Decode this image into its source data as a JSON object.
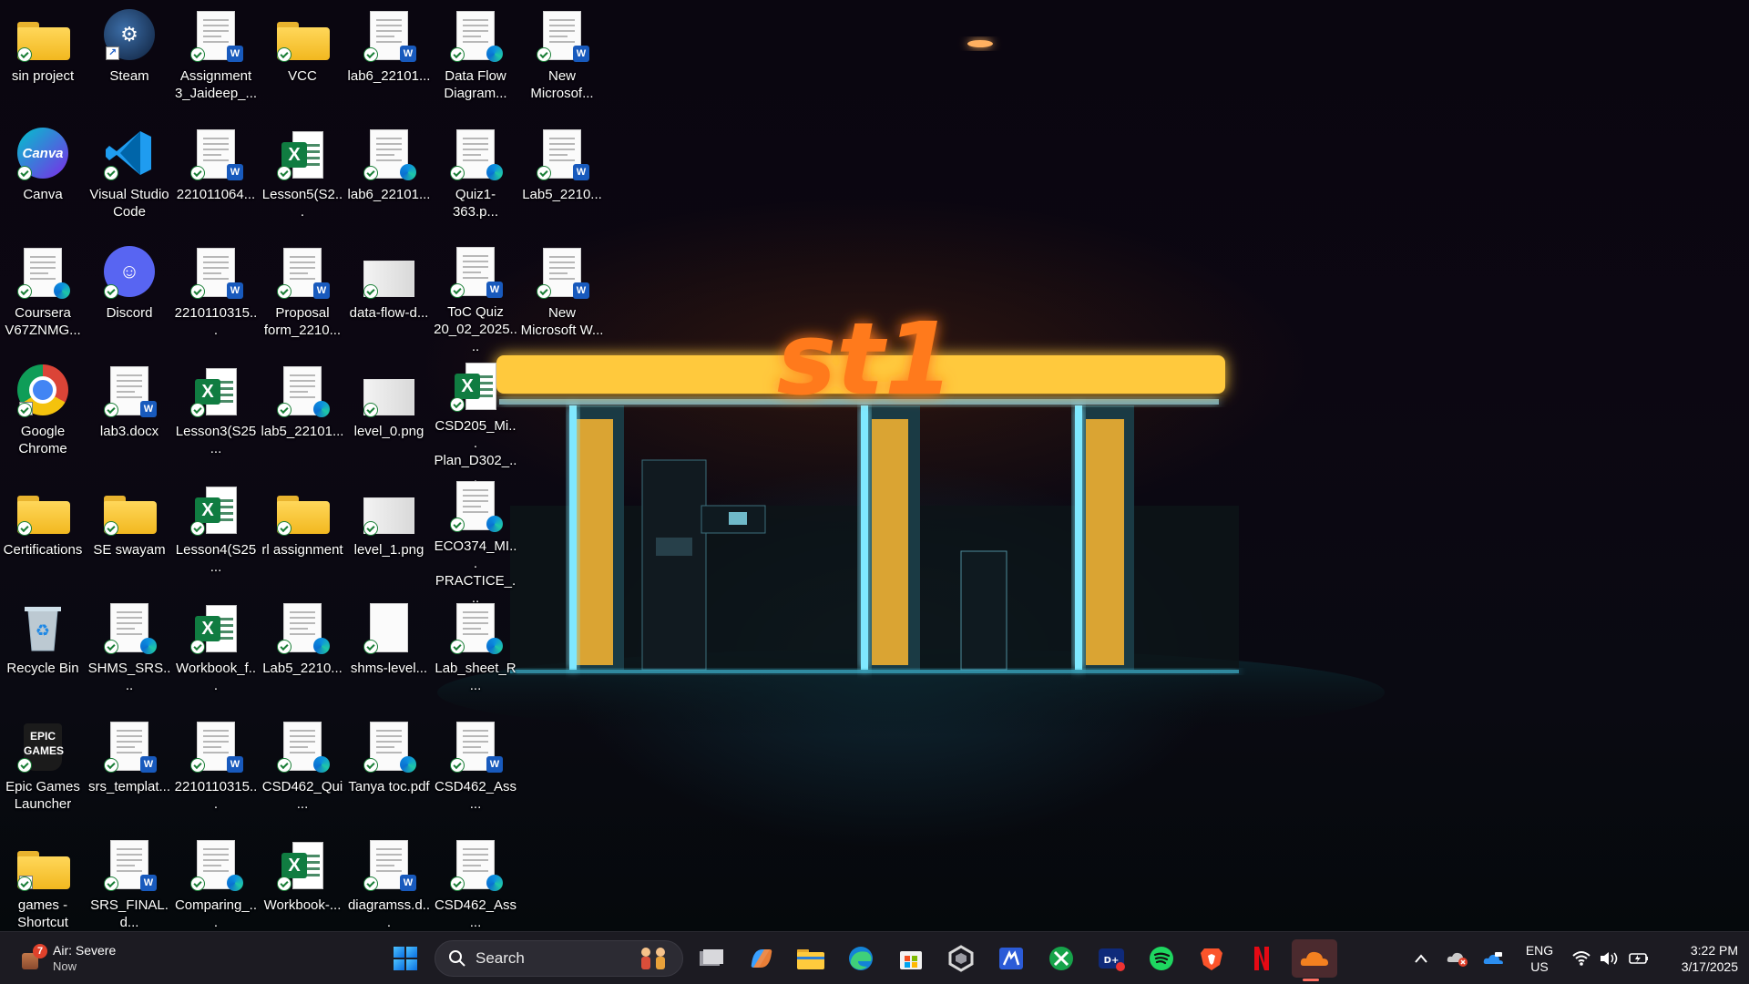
{
  "desktop": {
    "icons": [
      {
        "label": "sin project",
        "type": "folder"
      },
      {
        "label": "Steam",
        "type": "app"
      },
      {
        "label": "Assignment 3_Jaideep_...",
        "type": "word"
      },
      {
        "label": "VCC",
        "type": "folder"
      },
      {
        "label": "lab6_22101...",
        "type": "word"
      },
      {
        "label": "Data Flow Diagram...",
        "type": "pdf"
      },
      {
        "label": "New Microsof...",
        "type": "word"
      },
      {
        "label": "Canva",
        "type": "app"
      },
      {
        "label": "Visual Studio Code",
        "type": "app"
      },
      {
        "label": "221011064...",
        "type": "word"
      },
      {
        "label": "Lesson5(S2...",
        "type": "excel"
      },
      {
        "label": "lab6_22101...",
        "type": "pdf"
      },
      {
        "label": "Quiz1-363.p...",
        "type": "pdf"
      },
      {
        "label": "Lab5_2210...",
        "type": "word"
      },
      {
        "label": "Coursera V67ZNMG...",
        "type": "pdf"
      },
      {
        "label": "Discord",
        "type": "app"
      },
      {
        "label": "2210110315...",
        "type": "word"
      },
      {
        "label": "Proposal form_2210...",
        "type": "word"
      },
      {
        "label": "data-flow-d...",
        "type": "image"
      },
      {
        "label": "ToC Quiz 20_02_2025....",
        "type": "word"
      },
      {
        "label": "New Microsoft W...",
        "type": "word"
      },
      {
        "label": "Google Chrome",
        "type": "app"
      },
      {
        "label": "lab3.docx",
        "type": "word"
      },
      {
        "label": "Lesson3(S25...",
        "type": "excel"
      },
      {
        "label": "lab5_22101...",
        "type": "pdf"
      },
      {
        "label": "level_0.png",
        "type": "image"
      },
      {
        "label": "CSD205_Mi... Plan_D302_...",
        "type": "excel"
      },
      {
        "label": "Certifications",
        "type": "folder"
      },
      {
        "label": "SE swayam",
        "type": "folder"
      },
      {
        "label": "Lesson4(S25...",
        "type": "excel"
      },
      {
        "label": "rl assignment",
        "type": "folder"
      },
      {
        "label": "level_1.png",
        "type": "image"
      },
      {
        "label": "ECO374_MI... PRACTICE_...",
        "type": "pdf"
      },
      {
        "label": "Recycle Bin",
        "type": "recycle"
      },
      {
        "label": "SHMS_SRS....",
        "type": "pdf"
      },
      {
        "label": "Workbook_f...",
        "type": "excel"
      },
      {
        "label": "Lab5_2210...",
        "type": "pdf"
      },
      {
        "label": "shms-level...",
        "type": "blank"
      },
      {
        "label": "Lab_sheet_R...",
        "type": "pdf"
      },
      {
        "label": "Epic Games Launcher",
        "type": "app"
      },
      {
        "label": "srs_templat...",
        "type": "word"
      },
      {
        "label": "2210110315...",
        "type": "word"
      },
      {
        "label": "CSD462_Qui...",
        "type": "pdf"
      },
      {
        "label": "Tanya toc.pdf",
        "type": "pdf"
      },
      {
        "label": "CSD462_Ass...",
        "type": "word"
      },
      {
        "label": "games - Shortcut",
        "type": "folder"
      },
      {
        "label": "SRS_FINAL.d...",
        "type": "word"
      },
      {
        "label": "Comparing_...",
        "type": "pdf"
      },
      {
        "label": "Workbook-...",
        "type": "excel"
      },
      {
        "label": "diagramss.d...",
        "type": "word"
      },
      {
        "label": "CSD462_Ass...",
        "type": "pdf"
      }
    ]
  },
  "wallpaper": {
    "sign_text": "st1"
  },
  "taskbar": {
    "weather": {
      "title": "Air: Severe",
      "subtitle": "Now",
      "alert_count": "7"
    },
    "search": {
      "label": "Search"
    },
    "pinned": [
      "Task View",
      "Copilot",
      "File Explorer",
      "Microsoft Edge",
      "Microsoft Store",
      "Unity Hub",
      "Visual Studio",
      "Xbox",
      "Disney+",
      "Spotify",
      "Brave",
      "Netflix",
      "Cloudflare WARP"
    ],
    "tray": {
      "language": "ENG",
      "region": "US",
      "time": "3:22 PM",
      "date": "3/17/2025"
    }
  },
  "colors": {
    "taskbar_bg": "#1c1b22",
    "accent": "#0b6ee0",
    "sign_orange": "#ff7a1a",
    "canopy_yellow": "#ffc93c",
    "pillar_cyan": "#7fe8ff"
  }
}
